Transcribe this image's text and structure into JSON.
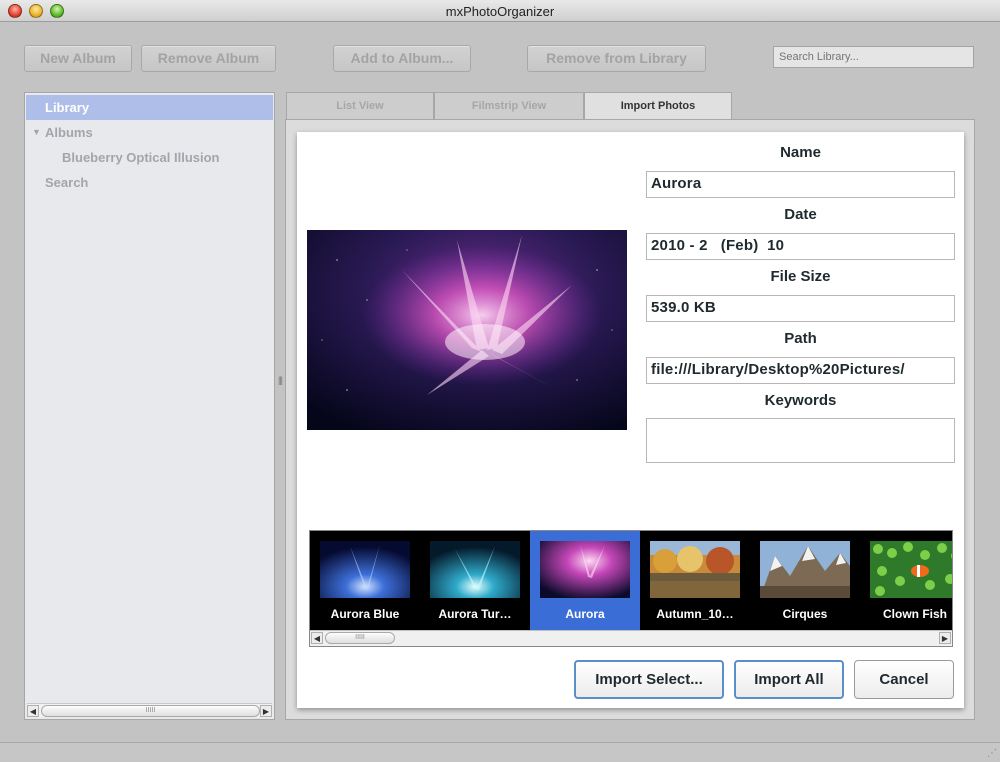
{
  "window": {
    "title": "mxPhotoOrganizer"
  },
  "toolbar": {
    "new_album": "New Album",
    "remove_album": "Remove Album",
    "add_to_album": "Add to Album...",
    "remove_from_library": "Remove from Library",
    "search_placeholder": "Search Library..."
  },
  "sidebar": {
    "items": [
      {
        "label": "Library",
        "selected": true
      },
      {
        "label": "Albums",
        "expanded": true
      },
      {
        "label": "Blueberry Optical Illusion"
      },
      {
        "label": "Search"
      }
    ],
    "scroll_thumb": "IIIII"
  },
  "tabs": [
    {
      "label": "List View",
      "active": false
    },
    {
      "label": "Filmstrip View",
      "active": false
    },
    {
      "label": "Import Photos",
      "active": true
    }
  ],
  "details": {
    "name_label": "Name",
    "name_value": "Aurora",
    "date_label": "Date",
    "date_value": "2010 - 2   (Feb)  10",
    "size_label": "File Size",
    "size_value": "539.0 KB",
    "path_label": "Path",
    "path_value": "file:///Library/Desktop%20Pictures/",
    "keywords_label": "Keywords",
    "keywords_value": ""
  },
  "filmstrip": {
    "items": [
      {
        "caption": "Aurora Blue",
        "selected": false
      },
      {
        "caption": "Aurora Tur…",
        "selected": false
      },
      {
        "caption": "Aurora",
        "selected": true
      },
      {
        "caption": "Autumn_10…",
        "selected": false
      },
      {
        "caption": "Cirques",
        "selected": false
      },
      {
        "caption": "Clown Fish",
        "selected": false
      }
    ],
    "scroll_thumb": "IIIII"
  },
  "actions": {
    "import_selected": "Import Select...",
    "import_all": "Import All",
    "cancel": "Cancel"
  },
  "colors": {
    "selection_sidebar": "#aebee8",
    "selection_filmstrip": "#3a6dd6",
    "default_button_border": "#5a8fc8"
  }
}
